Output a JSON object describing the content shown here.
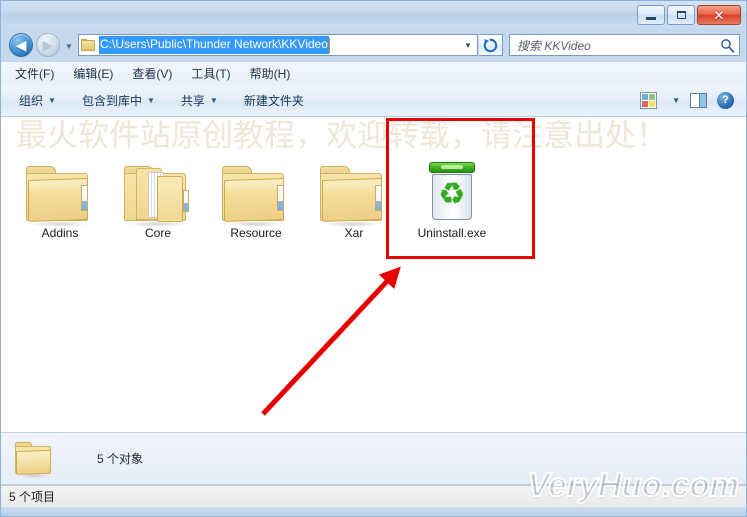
{
  "window": {
    "controls": {
      "minimize": "–",
      "maximize": "□",
      "close": "✕"
    }
  },
  "navigation": {
    "back_glyph": "◀",
    "forward_glyph": "▶",
    "history_caret": "▼",
    "address_path": "C:\\Users\\Public\\Thunder Network\\KKVideo",
    "address_caret": "▼",
    "refresh_glyph": "↻",
    "search_placeholder": "搜索 KKVideo",
    "search_icon_glyph": "🔍"
  },
  "menubar": {
    "items": [
      {
        "label": "文件(F)"
      },
      {
        "label": "编辑(E)"
      },
      {
        "label": "查看(V)"
      },
      {
        "label": "工具(T)"
      },
      {
        "label": "帮助(H)"
      }
    ]
  },
  "commandbar": {
    "items": [
      {
        "label": "组织",
        "caret": "▼"
      },
      {
        "label": "包含到库中",
        "caret": "▼"
      },
      {
        "label": "共享",
        "caret": "▼"
      },
      {
        "label": "新建文件夹",
        "caret": ""
      }
    ],
    "view_caret": "▼",
    "help_glyph": "?"
  },
  "files": {
    "items": [
      {
        "name": "Addins",
        "type": "folder"
      },
      {
        "name": "Core",
        "type": "folder-stack"
      },
      {
        "name": "Resource",
        "type": "folder"
      },
      {
        "name": "Xar",
        "type": "folder"
      },
      {
        "name": "Uninstall.exe",
        "type": "uninstaller"
      }
    ],
    "recycle_glyph": "♻"
  },
  "annotations": {
    "highlight_color": "#e60000",
    "arrow_color": "#e60000",
    "watermark_top": "最火软件站原创教程，欢迎转载，请注意出处！",
    "watermark_top_color": "#efe6d6",
    "watermark_bottom": "VeryHuo.com"
  },
  "details_pane": {
    "text": "5 个对象"
  },
  "statusbar": {
    "text": "5 个项目"
  }
}
